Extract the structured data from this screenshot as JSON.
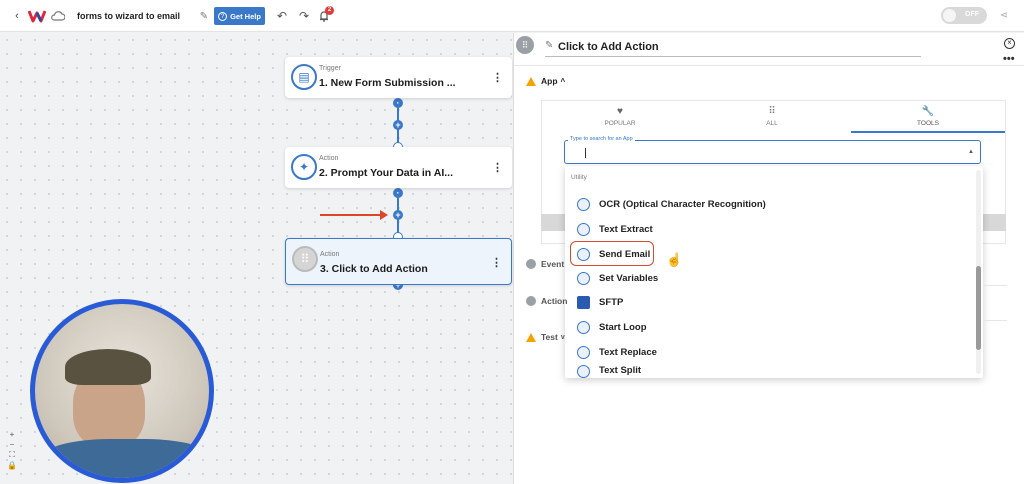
{
  "topbar": {
    "back_icon": "chevron-left-icon",
    "logo_icon": "w-logo-icon",
    "cloud_icon": "cloud-icon",
    "workflow_title": "forms to wizard to email",
    "edit_icon": "pencil-icon",
    "help_label": "Get Help",
    "undo_icon": "undo-icon",
    "redo_icon": "redo-icon",
    "notification_count": "2",
    "toggle_label": "OFF",
    "share_icon": "share-icon",
    "accent": "#3a78c9"
  },
  "canvas": {
    "nodes": [
      {
        "kind": "Trigger",
        "name": "1. New Form Submission ..."
      },
      {
        "kind": "Action",
        "name": "2. Prompt Your Data in AI..."
      },
      {
        "kind": "Action",
        "name": "3. Click to Add Action"
      }
    ],
    "zoom_controls": [
      "+",
      "−",
      "⛶",
      "🔒"
    ]
  },
  "panel": {
    "title": "Click to Add Action",
    "app_section": "App",
    "tabs": [
      {
        "label": "POPULAR",
        "icon": "heart-icon"
      },
      {
        "label": "ALL",
        "icon": "grid-icon"
      },
      {
        "label": "TOOLS",
        "icon": "wrench-icon"
      }
    ],
    "search_placeholder": "Type to search for an App",
    "dropdown_group": "Utility",
    "dropdown_items": [
      "OCR (Optical Character Recognition)",
      "Text Extract",
      "Send Email",
      "Set Variables",
      "SFTP",
      "Start Loop",
      "Text Replace",
      "Text Split"
    ],
    "sections": [
      {
        "label": "Event"
      },
      {
        "label": "Action"
      },
      {
        "label": "Test"
      }
    ]
  }
}
